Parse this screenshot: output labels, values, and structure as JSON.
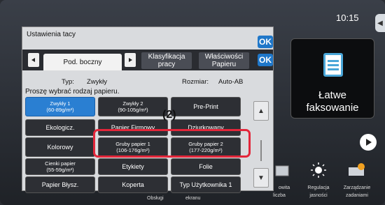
{
  "status": {
    "time": "10:15"
  },
  "home": {
    "fax_label": "Łatwe\nfaksowanie",
    "bottom": [
      {
        "label": "liczba",
        "icon": "counter-icon"
      },
      {
        "label": "Regulacja\njasności",
        "icon": "brightness-icon"
      },
      {
        "label": "Zarządzanie\nzadaniami",
        "icon": "job-status-icon"
      }
    ],
    "dim_labels": [
      "Obsługi",
      "ekranu"
    ],
    "partial_label": "owita"
  },
  "panel": {
    "title": "Ustawienia tacy",
    "ok_label": "OK",
    "tabs": [
      {
        "label": "Pod. boczny",
        "active": true
      },
      {
        "label": "Klasyfikacja\npracy",
        "active": false
      },
      {
        "label": "Właściwości\nPapieru",
        "active": false
      }
    ],
    "type_label": "Typ:",
    "type_value": "Zwykły",
    "size_label": "Rozmiar:",
    "size_value": "Auto-AB",
    "prompt": "Proszę wybrać rodzaj papieru.",
    "paper_types": [
      [
        "Zwykły 1\n(60-89g/m²)",
        "Zwykły 2\n(90-105g/m²)",
        "Pre-Print"
      ],
      [
        "Ekologicz.",
        "Papier Firmowy",
        "Dziurkowany"
      ],
      [
        "Kolorowy",
        "Gruby papier 1\n(106-176g/m²)",
        "Gruby papier 2\n(177-220g/m²)"
      ],
      [
        "Cienki papier\n(55-59g/m²)",
        "Etykiety",
        "Folie"
      ],
      [
        "Papier Błysz.",
        "Koperta",
        "Typ Użytkownika 1"
      ]
    ]
  },
  "callout": {
    "label": "(2)"
  },
  "colors": {
    "accent": "#2a7fd2",
    "highlight": "#e3263a"
  }
}
